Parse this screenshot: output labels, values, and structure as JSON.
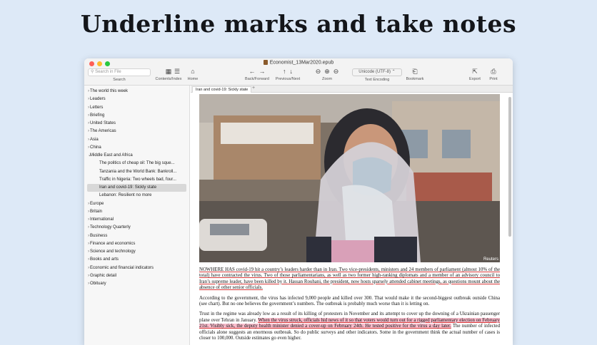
{
  "headline": "Underline marks and take notes",
  "window": {
    "title": "Economist_13Mar2020.epub",
    "traffic_colors": [
      "#fe5f57",
      "#febc2e",
      "#28c840"
    ]
  },
  "toolbar": {
    "search_placeholder": "Search in File",
    "search_label": "Search",
    "contents_label": "Contents/Index",
    "home_label": "Home",
    "back_forward_label": "Back/Forward",
    "prev_next_label": "Previous/Next",
    "zoom_label": "Zoom",
    "encoding_value": "Unicode (UTF-8)",
    "encoding_label": "Text Encoding",
    "bookmark_label": "Bookmark",
    "export_label": "Export",
    "print_label": "Print"
  },
  "sidebar": {
    "items": [
      {
        "label": "The world this week",
        "kind": "collapsed"
      },
      {
        "label": "Leaders",
        "kind": "collapsed"
      },
      {
        "label": "Letters",
        "kind": "collapsed"
      },
      {
        "label": "Briefing",
        "kind": "collapsed"
      },
      {
        "label": "United States",
        "kind": "collapsed"
      },
      {
        "label": "The Americas",
        "kind": "collapsed"
      },
      {
        "label": "Asia",
        "kind": "collapsed"
      },
      {
        "label": "China",
        "kind": "collapsed"
      },
      {
        "label": "Middle East and Africa",
        "kind": "expanded"
      },
      {
        "label": "The politics of cheap oil: The big sque...",
        "kind": "child"
      },
      {
        "label": "Tanzania and the World Bank: Bankroll...",
        "kind": "child"
      },
      {
        "label": "Traffic in Nigeria: Two wheels bad, four...",
        "kind": "child"
      },
      {
        "label": "Iran and covid-19: Sickly state",
        "kind": "selected"
      },
      {
        "label": "Lebanon: Resilient no more",
        "kind": "child"
      },
      {
        "label": "Europe",
        "kind": "collapsed"
      },
      {
        "label": "Britain",
        "kind": "collapsed"
      },
      {
        "label": "International",
        "kind": "collapsed"
      },
      {
        "label": "Technology Quarterly",
        "kind": "collapsed"
      },
      {
        "label": "Business",
        "kind": "collapsed"
      },
      {
        "label": "Finance and economics",
        "kind": "collapsed"
      },
      {
        "label": "Science and technology",
        "kind": "collapsed"
      },
      {
        "label": "Books and arts",
        "kind": "collapsed"
      },
      {
        "label": "Economic and financial indicators",
        "kind": "collapsed"
      },
      {
        "label": "Graphic detail",
        "kind": "collapsed"
      },
      {
        "label": "Obituary",
        "kind": "collapsed"
      }
    ]
  },
  "tab": {
    "label": "Iran and covid-19: Sickly state",
    "plus": "+"
  },
  "photo": {
    "caption": "Reuters"
  },
  "article": {
    "p1": "NOWHERE HAS covid-19 hit a country’s leaders harder than in Iran. Two vice-presidents, ministers and 24 members of parliament (almost 10% of the total) have contracted the virus. Two of those parliamentarians, as well as two former high-ranking diplomats and a member of an advisory council to Iran’s supreme leader, have been killed by it. Hassan Rouhani, the president, now hosts sparsely attended cabinet meetings, as questions mount about the absence of other senior officials.",
    "p2": "According to the government, the virus has infected 9,000 people and killed over 300. That would make it the second-biggest outbreak outside China (see chart). But no one believes the government’s numbers. The outbreak is probably much worse than it is letting on.",
    "p3a": "Trust in the regime was already low as a result of its killing of protesters in November and its attempt to cover up the downing of a Ukrainian passenger plane over Tehran in January. ",
    "p3b": "When the virus struck, officials hid news of it so that voters would turn out for a rigged parliamentary election on February 21st. Visibly sick, the deputy health minister denied a cover-up on February 24th. He tested positive for the virus a day later.",
    "p3c": " The number of infected officials alone suggests an enormous outbreak. So do public surveys and other indicators. Some in the government think the actual number of cases is closer to 100,000. Outside estimates go even higher."
  }
}
